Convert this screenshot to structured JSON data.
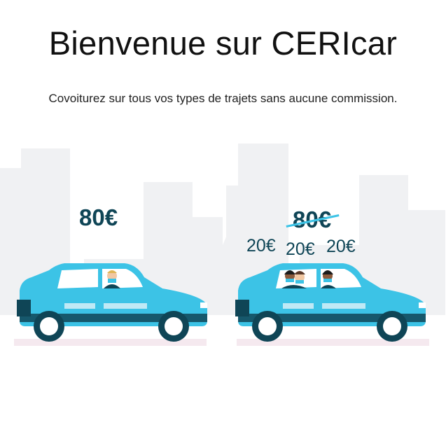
{
  "header": {
    "title": "Bienvenue sur CERIcar",
    "subtitle": "Covoiturez sur tous vos types de trajets sans aucune commission."
  },
  "illustration_left": {
    "price": "80€"
  },
  "illustration_right": {
    "old_price": "80€",
    "shared_prices": [
      "20€",
      "20€",
      "20€"
    ]
  },
  "colors": {
    "car_body": "#3cc3e6",
    "car_dark": "#0f4556",
    "city_background": "#f0f1f3",
    "price_text": "#0f4556"
  }
}
